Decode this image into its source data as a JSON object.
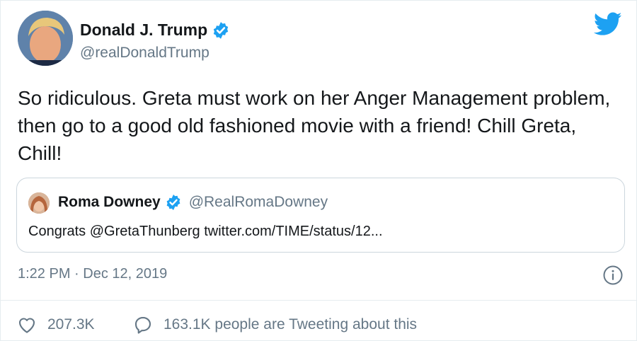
{
  "author": {
    "display_name": "Donald J. Trump",
    "handle": "@realDonaldTrump",
    "verified_icon": "verified-badge-icon"
  },
  "tweet": {
    "text": "So ridiculous. Greta must work on her Anger Management problem, then go to a good old fashioned movie with a friend! Chill Greta, Chill!"
  },
  "quoted_tweet": {
    "display_name": "Roma Downey",
    "handle": "@RealRomaDowney",
    "text": "Congrats @GretaThunberg twitter.com/TIME/status/12..."
  },
  "meta": {
    "timestamp": "1:22 PM · Dec 12, 2019"
  },
  "actions": {
    "likes": "207.3K",
    "conversation": "163.1K people are Tweeting about this"
  },
  "colors": {
    "brand_blue": "#1da1f2",
    "secondary_text": "#657786",
    "border": "#ccd6dd"
  }
}
